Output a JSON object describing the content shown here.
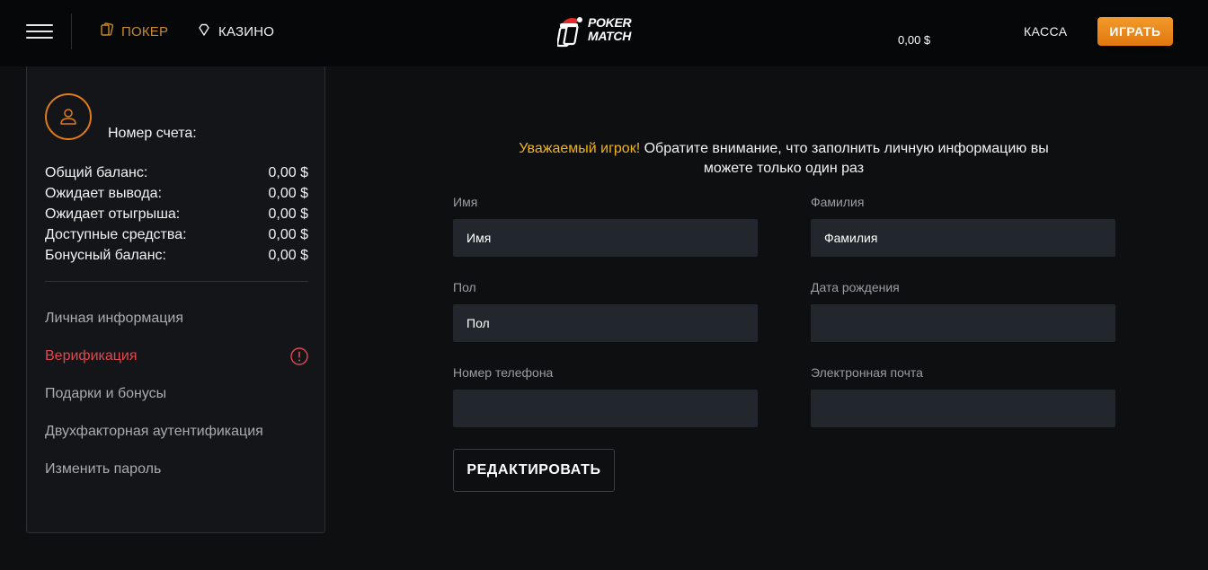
{
  "header": {
    "nav": [
      {
        "label": "ПОКЕР",
        "icon": "cards-icon",
        "color": "#c98a2c"
      },
      {
        "label": "КАЗИНО",
        "icon": "diamond-icon"
      }
    ],
    "logo": {
      "line1": "POKER",
      "line2": "MATCH"
    },
    "balance": "0,00 $",
    "cashier_label": "КАССА",
    "play_label": "ИГРАТЬ",
    "accent": "#f08c1c"
  },
  "sidebar": {
    "account_label": "Номер счета:",
    "balances": [
      {
        "label": "Общий баланс:",
        "value": "0,00 $"
      },
      {
        "label": "Ожидает вывода:",
        "value": "0,00 $"
      },
      {
        "label": "Ожидает отыгрыша:",
        "value": "0,00 $"
      },
      {
        "label": "Доступные средства:",
        "value": "0,00 $"
      },
      {
        "label": "Бонусный баланс:",
        "value": "0,00 $"
      }
    ],
    "menu": [
      {
        "label": "Личная информация"
      },
      {
        "label": "Верификация",
        "active": true
      },
      {
        "label": "Подарки и бонусы"
      },
      {
        "label": "Двухфакторная аутентификация"
      },
      {
        "label": "Изменить пароль"
      }
    ]
  },
  "main": {
    "notice_highlight": "Уважаемый игрок!",
    "notice_text": " Обратите внимание, что заполнить личную информацию вы можете только один раз",
    "fields": {
      "first_name": {
        "label": "Имя",
        "value": "Имя"
      },
      "last_name": {
        "label": "Фамилия",
        "value": "Фамилия"
      },
      "gender": {
        "label": "Пол",
        "value": "Пол"
      },
      "birth_date": {
        "label": "Дата рождения",
        "value": ""
      },
      "phone": {
        "label": "Номер телефона",
        "value": ""
      },
      "email": {
        "label": "Электронная почта",
        "value": ""
      }
    },
    "edit_label": "РЕДАКТИРОВАТЬ"
  }
}
